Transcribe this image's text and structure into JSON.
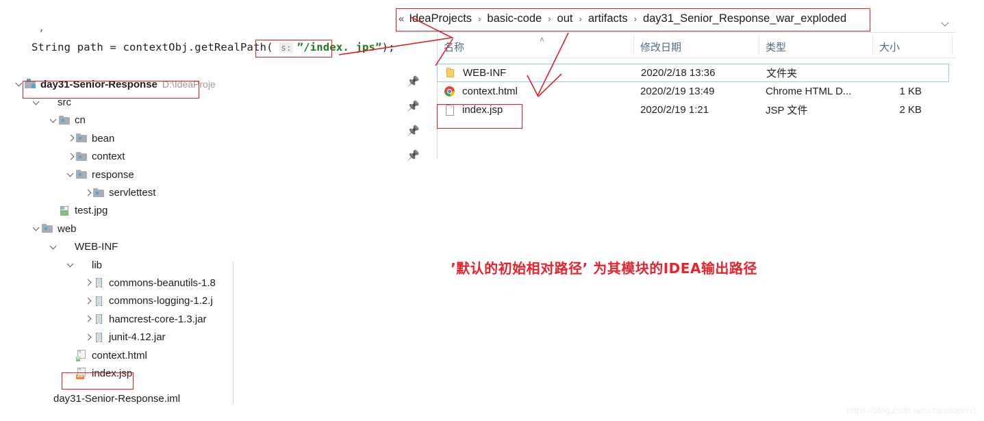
{
  "code": {
    "stray_mark": "’",
    "line_prefix": "String path = contextObj.getRealPath( ",
    "param_hint": "s:",
    "string_literal": "”/index. jps”",
    "line_suffix": ");"
  },
  "project_tree": {
    "items": [
      {
        "indent": 0,
        "chevron": "down",
        "icon": "module",
        "label": "day31-Senior-Response",
        "bold": true,
        "path": "D:\\IdeaProje"
      },
      {
        "indent": 1,
        "chevron": "down",
        "icon": "src",
        "label": "src",
        "bold": false,
        "path": ""
      },
      {
        "indent": 2,
        "chevron": "down",
        "icon": "folder",
        "label": "cn",
        "bold": false,
        "path": ""
      },
      {
        "indent": 3,
        "chevron": "right",
        "icon": "folder",
        "label": "bean",
        "bold": false,
        "path": ""
      },
      {
        "indent": 3,
        "chevron": "right",
        "icon": "folder",
        "label": "context",
        "bold": false,
        "path": ""
      },
      {
        "indent": 3,
        "chevron": "down",
        "icon": "folder",
        "label": "response",
        "bold": false,
        "path": ""
      },
      {
        "indent": 4,
        "chevron": "right",
        "icon": "folder",
        "label": "servlettest",
        "bold": false,
        "path": ""
      },
      {
        "indent": 2,
        "chevron": "blank",
        "icon": "img",
        "label": "test.jpg",
        "bold": false,
        "path": ""
      },
      {
        "indent": 1,
        "chevron": "down",
        "icon": "folder",
        "label": "web",
        "bold": false,
        "path": ""
      },
      {
        "indent": 2,
        "chevron": "down",
        "icon": "plain",
        "label": "WEB-INF",
        "bold": false,
        "path": ""
      },
      {
        "indent": 3,
        "chevron": "down",
        "icon": "plain",
        "label": "lib",
        "bold": false,
        "path": ""
      },
      {
        "indent": 4,
        "chevron": "right",
        "icon": "jar",
        "label": "commons-beanutils-1.8",
        "bold": false,
        "path": ""
      },
      {
        "indent": 4,
        "chevron": "right",
        "icon": "jar",
        "label": "commons-logging-1.2.j",
        "bold": false,
        "path": ""
      },
      {
        "indent": 4,
        "chevron": "right",
        "icon": "jar",
        "label": "hamcrest-core-1.3.jar",
        "bold": false,
        "path": ""
      },
      {
        "indent": 4,
        "chevron": "right",
        "icon": "jar",
        "label": "junit-4.12.jar",
        "bold": false,
        "path": ""
      },
      {
        "indent": 3,
        "chevron": "blank",
        "icon": "html",
        "label": "context.html",
        "bold": false,
        "path": ""
      },
      {
        "indent": 3,
        "chevron": "blank",
        "icon": "jsp",
        "label": "index.jsp",
        "bold": false,
        "path": ""
      }
    ],
    "icon_tags": {
      "html": "H",
      "jsp": "JSP"
    },
    "cut_off_row": "day31-Senior-Response.iml"
  },
  "explorer": {
    "breadcrumb": {
      "overflow_glyph": "«",
      "separator": "›",
      "crumbs": [
        "IdeaProjects",
        "basic-code",
        "out",
        "artifacts",
        "day31_Senior_Response_war_exploded"
      ]
    },
    "pin_icons": [
      "pin-icon",
      "pin-icon",
      "pin-icon",
      "pin-icon"
    ],
    "columns": [
      "名称",
      "修改日期",
      "类型",
      "大小"
    ],
    "sort_caret": "˄",
    "rows": [
      {
        "icon": "folder-y",
        "name": "WEB-INF",
        "date": "2020/2/18 13:36",
        "type": "文件夹",
        "size": "",
        "selected": true
      },
      {
        "icon": "chrome",
        "name": "context.html",
        "date": "2020/2/19 13:49",
        "type": "Chrome HTML D...",
        "size": "1 KB",
        "selected": false
      },
      {
        "icon": "doc",
        "name": "index.jsp",
        "date": "2020/2/19 1:21",
        "type": "JSP 文件",
        "size": "2 KB",
        "selected": false
      }
    ]
  },
  "annotation": {
    "note": "’默认的初始相对路径’ 为其模块的IDEA输出路径"
  },
  "watermark": {
    "url": "https://blog.csdn.net/chinatopno1"
  },
  "colors": {
    "annotation_red": "#e8232a",
    "box_red": "#e02020",
    "selection_blue": "#9cc8ea",
    "header_blue": "#4f6b8a",
    "string_green": "#1a7a1a"
  }
}
